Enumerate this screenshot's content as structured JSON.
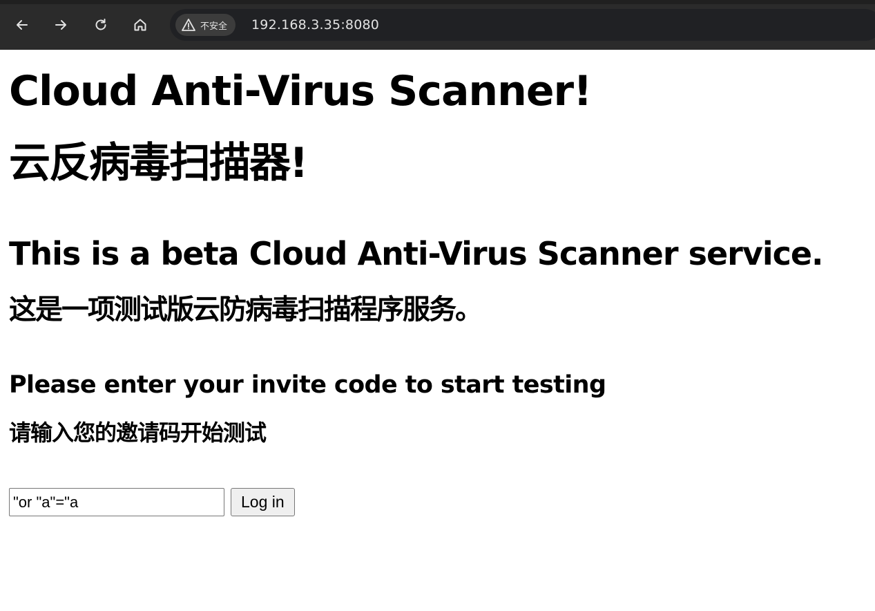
{
  "browser": {
    "nav_icons": {
      "back": "back-arrow-icon",
      "forward": "forward-arrow-icon",
      "reload": "reload-icon",
      "home": "home-icon"
    },
    "security_label": "不安全",
    "url": "192.168.3.35:8080",
    "colors": {
      "toolbar_bg": "#2b2b2b",
      "omnibox_bg": "#202124",
      "text": "#e3e3e3"
    }
  },
  "page": {
    "title_en": "Cloud Anti-Virus Scanner!",
    "title_zh": "云反病毒扫描器!",
    "subtitle_en": "This is a beta Cloud Anti-Virus Scanner service.",
    "subtitle_zh": "这是一项测试版云防病毒扫描程序服务。",
    "prompt_en": "Please enter your invite code to start testing",
    "prompt_zh": "请输入您的邀请码开始测试",
    "invite_code_value": "\"or \"a\"=\"a",
    "login_button": "Log in"
  }
}
